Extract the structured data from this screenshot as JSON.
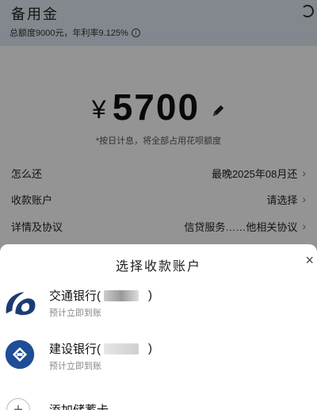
{
  "header": {
    "title": "备用金",
    "subtitle": "总额度9000元，年利率9.125%",
    "info_icon": "i"
  },
  "amount": {
    "currency": "¥",
    "value": "5700",
    "note": "*按日计息，将全部占用花呗额度"
  },
  "rows": [
    {
      "label": "怎么还",
      "value": "最晚2025年08月还"
    },
    {
      "label": "收款账户",
      "value": "请选择"
    },
    {
      "label": "详情及协议",
      "value": "信贷服务……他相关协议"
    }
  ],
  "chevron": "›",
  "sheet": {
    "title": "选择收款账户",
    "close": "×",
    "banks": [
      {
        "name": "交通银行(",
        "close_paren": ")",
        "sub": "预计立即到账",
        "brand_color": "#1d3b73"
      },
      {
        "name": "建设银行(",
        "close_paren": ")",
        "sub": "预计立即到账",
        "brand_color": "#1f4d97"
      }
    ],
    "add": {
      "icon": "+",
      "label": "添加储蓄卡"
    }
  }
}
